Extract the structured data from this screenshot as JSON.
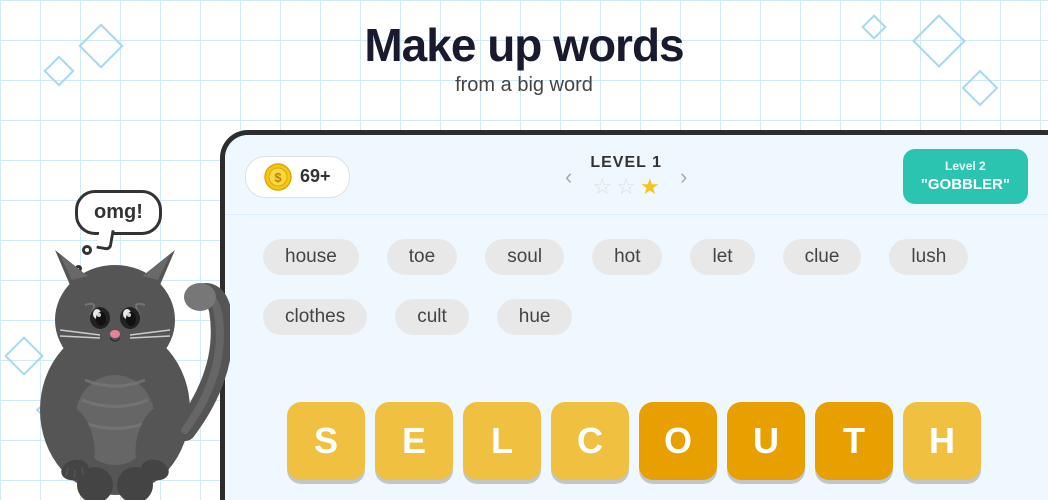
{
  "header": {
    "title": "Make up words",
    "subtitle": "from a big word"
  },
  "speech": {
    "text": "omg!"
  },
  "topbar": {
    "coins": "69+",
    "level_label": "LEVEL 1",
    "arrow_left": "‹",
    "arrow_right": "›",
    "stars": [
      false,
      false,
      true
    ],
    "next_level_label": "Level 2",
    "next_level_name": "\"GOBBLER\""
  },
  "words": [
    "house",
    "toe",
    "soul",
    "hot",
    "let",
    "clue",
    "lush",
    "clothes",
    "cult",
    "hue"
  ],
  "letters": [
    "S",
    "E",
    "L",
    "C",
    "O",
    "U",
    "T",
    "H"
  ],
  "highlight_indices": [
    4,
    5,
    6
  ],
  "colors": {
    "tile_normal": "#f0c040",
    "tile_highlight": "#e8a000",
    "panel_bg": "#f0f8ff",
    "next_btn": "#2bc4b0"
  }
}
